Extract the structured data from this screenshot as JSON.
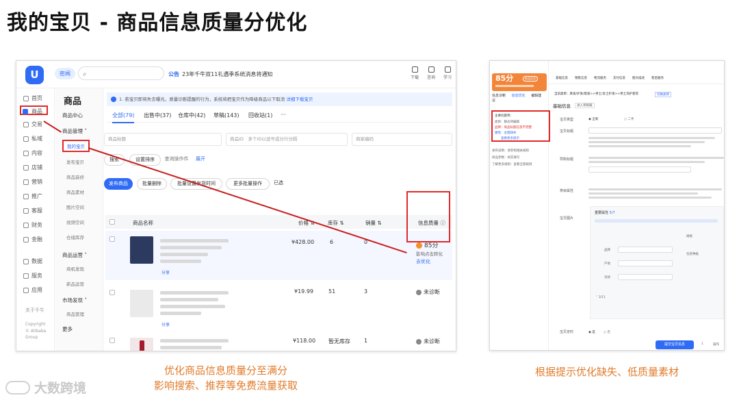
{
  "slide": {
    "title": "我的宝贝 - 商品信息质量分优化",
    "caption_left_1": "优化商品信息质量分至满分",
    "caption_left_2": "影响搜索、推荐等免费流量获取",
    "caption_right": "根据提示优化缺失、低质量素材",
    "brand": "大数跨境"
  },
  "left_screen": {
    "logo": "U",
    "chip": "密闻",
    "search_placeholder": "",
    "notice_label": "公告",
    "notice_text": "23年千牛双11礼遇季系统消息将通知",
    "tools": [
      "下载",
      "咨询",
      "学习"
    ],
    "nav": [
      "首页",
      "商品",
      "交易",
      "私域",
      "内容",
      "店铺",
      "营销",
      "推广",
      "客服",
      "财务",
      "金融",
      "数据",
      "服务",
      "应用"
    ],
    "nav_footer": [
      "关于千牛",
      "Copyright",
      "© Alibaba Group"
    ],
    "sub_title": "商品",
    "sub_groups": [
      "商品中心",
      "商品管理",
      "商品运营",
      "市场发现"
    ],
    "sub_items": [
      "我的宝贝",
      "发布宝贝",
      "商品装修",
      "商品素材",
      "图片空间",
      "视频空间",
      "仓储库存"
    ],
    "sub_items_ops": [
      "商机发现",
      "新品运营"
    ],
    "sub_items_market": [
      "商品管理",
      "更多"
    ],
    "sub_more": "更多",
    "tip_text": "1. 若宝贝即将失去曝光，质量诊断提醒的行为，系统将把宝贝作为降级商品以下取消",
    "tip_link": "详细下载宝贝",
    "tabs": [
      "全部(79)",
      "出售中(37)",
      "仓库中(42)",
      "草稿(143)",
      "回收站(1)",
      "···"
    ],
    "filters": {
      "title": "商品标题",
      "id": "商品ID",
      "id_placeholder": "多个ID以逗号或分行分隔",
      "code": "商家编码"
    },
    "filter_buttons": [
      "搜索",
      "设置排序",
      "查询操作件",
      "展开"
    ],
    "actions": [
      "发布商品",
      "批量删除",
      "批量设置发货时间",
      "更多批量操作",
      "已选"
    ],
    "columns": [
      "商品名称",
      "价格",
      "库存",
      "销量",
      "信息质量"
    ],
    "rows": [
      {
        "price": "¥428.00",
        "stock": "6",
        "sales": "0",
        "quality": "85分",
        "quality_note": "影响点击转化",
        "action": "去优化",
        "share": "分享"
      },
      {
        "price": "¥19.99",
        "stock": "51",
        "sales": "3",
        "quality": "未诊断",
        "share": "分享"
      },
      {
        "price": "¥118.00",
        "stock": "暂无库存",
        "sales": "1",
        "quality": "未诊断",
        "share": "分享"
      }
    ]
  },
  "right_screen": {
    "score": "85分",
    "score_badge": "新品优化",
    "tabs": [
      "信息诊断",
      "信息优化",
      "编辑建议"
    ],
    "issues_title": "主要问题项：",
    "issues": [
      "类目：静态待编辑",
      "品牌：商品标题信息不完整",
      "属性：主图缺失"
    ],
    "issues_link": "查看更多提示",
    "side_tips": [
      "发布说明：请参照相关规则",
      "商品参数：如实填写",
      "了解更多规则：查看全部规则"
    ],
    "topnav": [
      "基础信息",
      "销售信息",
      "物流服务",
      "支付信息",
      "图文描述",
      "售后服务"
    ],
    "breadcrumb": "当前类目：真发/护发/假发>>男士/女士护发>>男士洗护套装",
    "breadcrumb_link": "切换类目",
    "section_title": "基础信息",
    "section_badge": "进入草稿箱",
    "labels": [
      "宝贝类型",
      "宝贝标题",
      "导购标题",
      "类目属性",
      "宝贝图片"
    ],
    "radio": [
      "全新",
      "二手"
    ],
    "attr_title": "重要属性",
    "attr_count": "5/7",
    "attr_fields": [
      "品牌",
      "产地",
      "功效",
      "规格",
      "包装种类"
    ],
    "attr_count_2": "3/11",
    "bottom_label": "宝贝定时",
    "bottom_radio": [
      "是",
      "否"
    ],
    "submit": "提交宝贝信息",
    "page_count": "1",
    "page_right": "操作"
  }
}
